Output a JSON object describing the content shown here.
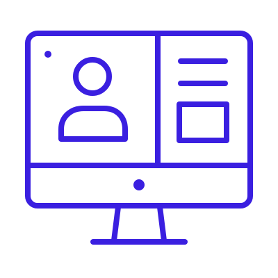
{
  "icon": {
    "name": "desktop-profile-icon",
    "stroke_color": "#3A1FE0",
    "background": "#FFFFFF"
  }
}
